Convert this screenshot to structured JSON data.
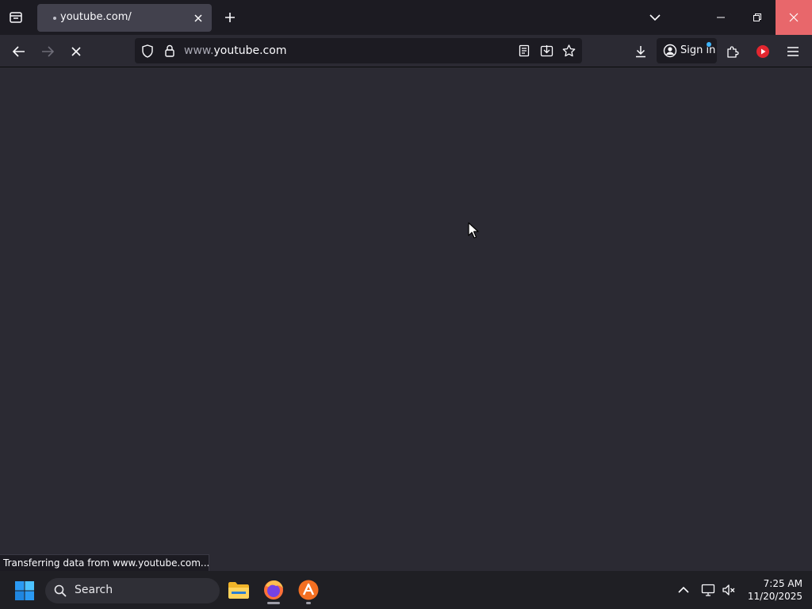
{
  "browser": {
    "tab": {
      "title": "youtube.com/"
    },
    "url": {
      "prefix": "www.",
      "domain": "youtube.com"
    },
    "signin_label": "Sign in",
    "status_text": "Transferring data from www.youtube.com..."
  },
  "taskbar": {
    "search_label": "Search",
    "time": "7:25 AM",
    "date": "11/20/2025"
  },
  "colors": {
    "window_close_hover": "#e8676b",
    "youtube_red": "#ff0000",
    "page_background": "#2b2a33"
  }
}
